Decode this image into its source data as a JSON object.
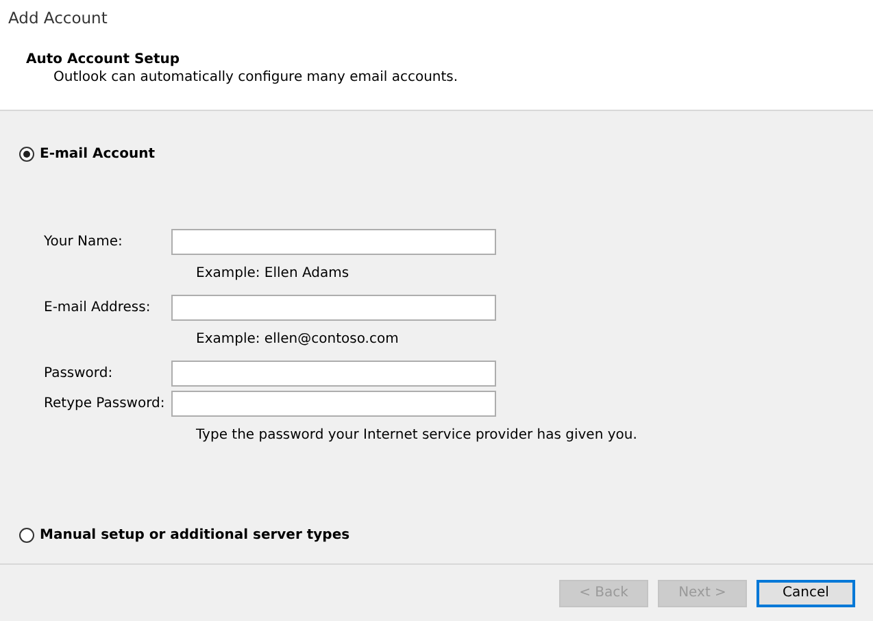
{
  "window": {
    "title": "Add Account"
  },
  "header": {
    "title": "Auto Account Setup",
    "subtitle": "Outlook can automatically configure many email accounts."
  },
  "options": [
    {
      "label": "E-mail Account",
      "selected": true
    },
    {
      "label": "Manual setup or additional server types",
      "selected": false
    }
  ],
  "fields": [
    {
      "label": "Your Name:",
      "hint": "Example: Ellen Adams"
    },
    {
      "label": "E-mail Address:",
      "hint": "Example: ellen@contoso.com"
    },
    {
      "label": "Password:"
    },
    {
      "label": "Retype Password:",
      "hint": "Type the password your Internet service provider has given you."
    }
  ],
  "buttons": [
    {
      "label": "< Back",
      "disabled": true,
      "default": false
    },
    {
      "label": "Next >",
      "disabled": true,
      "default": false
    },
    {
      "label": "Cancel",
      "disabled": false,
      "default": true
    }
  ]
}
